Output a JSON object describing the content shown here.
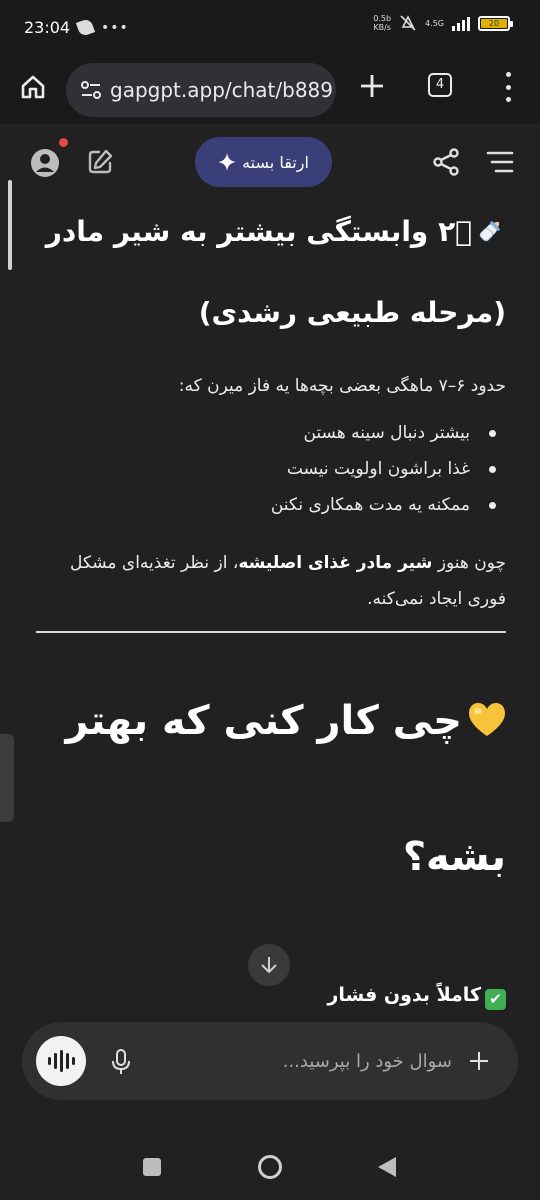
{
  "status_bar": {
    "time": "23:04",
    "net_speed_value": "0.5b",
    "net_speed_unit": "KB/s",
    "network": "4.5G",
    "battery_level": "20"
  },
  "browser": {
    "url": "gapgpt.app/chat/b889",
    "tab_count": "4"
  },
  "header": {
    "upgrade_label": "ارتقا بسته"
  },
  "message": {
    "heading_2_line1": "۲️⃣ وابستگی بیشتر به شیر مادر",
    "heading_2_line2": "(مرحله طبیعی رشدی)",
    "intro": "حدود ۶–۷ ماهگی بعضی بچه‌ها یه فاز میرن که:",
    "bullets": [
      "بیشتر دنبال سینه هستن",
      "غذا براشون اولویت نیست",
      "ممکنه یه مدت همکاری نکنن"
    ],
    "body_prefix": "چون هنوز ",
    "body_bold": "شیر مادر غذای اصلیشه",
    "body_suffix": "، از نظر تغذیه‌ای مشکل فوری ایجاد نمی‌کنه.",
    "heading_1_line1": "چی کار کنی که بهتر",
    "heading_1_line2": "بشه؟",
    "check_item": "کاملاً بدون فشار"
  },
  "input": {
    "placeholder": "سوال خود را بپرسید..."
  },
  "colors": {
    "background": "#212121",
    "upgrade_button": "#3a3f7a",
    "notification_dot": "#e5484d",
    "check_green": "#3fae54",
    "heart_yellow": "#f6c33a"
  }
}
